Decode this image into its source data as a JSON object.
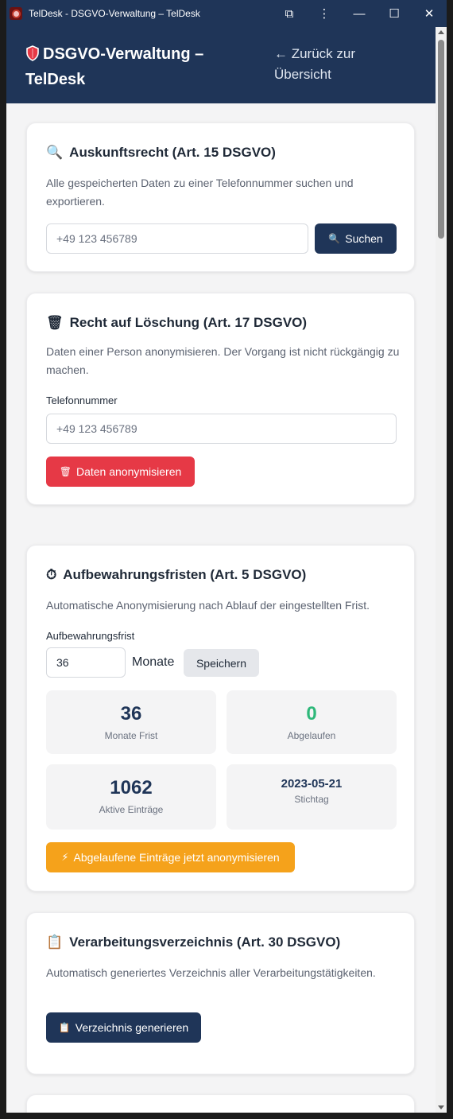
{
  "window": {
    "title": "TelDesk - DSGVO-Verwaltung – TelDesk",
    "extensions_glyph": "⧉",
    "menu_glyph": "⋮",
    "minimize_glyph": "—",
    "maximize_glyph": "☐",
    "close_glyph": "✕"
  },
  "header": {
    "title": "DSGVO-Verwaltung – TelDesk",
    "back_link": "← Zurück zur Übersicht"
  },
  "auskunft": {
    "icon": "🔍",
    "title": "Auskunftsrecht (Art. 15 DSGVO)",
    "description": "Alle gespeicherten Daten zu einer Telefonnummer suchen und exportieren.",
    "phone_placeholder": "+49 123 456789",
    "search_icon": "🔍",
    "search_label": "Suchen"
  },
  "loeschung": {
    "icon": "🗑",
    "title": "Recht auf Löschung (Art. 17 DSGVO)",
    "description": "Daten einer Person anonymisieren. Der Vorgang ist nicht rückgängig zu machen.",
    "phone_label": "Telefonnummer",
    "phone_placeholder": "+49 123 456789",
    "button_icon": "🗑",
    "button_label": "Daten anonymisieren"
  },
  "fristen": {
    "icon": "⏱",
    "title": "Aufbewahrungsfristen (Art. 5 DSGVO)",
    "description": "Automatische Anonymisierung nach Ablauf der eingestellten Frist.",
    "retention_label": "Aufbewahrungsfrist",
    "retention_value": "36",
    "unit": "Monate",
    "save_label": "Speichern",
    "stats": [
      {
        "value": "36",
        "label": "Monate Frist"
      },
      {
        "value": "0",
        "label": "Abgelaufen"
      },
      {
        "value": "1062",
        "label": "Aktive Einträge"
      },
      {
        "value": "2023-05-21",
        "label": "Stichtag"
      }
    ],
    "anonymize_icon": "⚡",
    "anonymize_label": "Abgelaufene Einträge jetzt anonymisieren"
  },
  "verzeichnis": {
    "icon": "📋",
    "title": "Verarbeitungsverzeichnis (Art. 30 DSGVO)",
    "description": "Automatisch generiertes Verzeichnis aller Verarbeitungstätigkeiten.",
    "button_icon": "📋",
    "button_label": "Verzeichnis generieren"
  },
  "colors": {
    "navy": "#1f3558",
    "danger": "#e63946",
    "warning": "#f5a21b",
    "success": "#2eb87a"
  }
}
